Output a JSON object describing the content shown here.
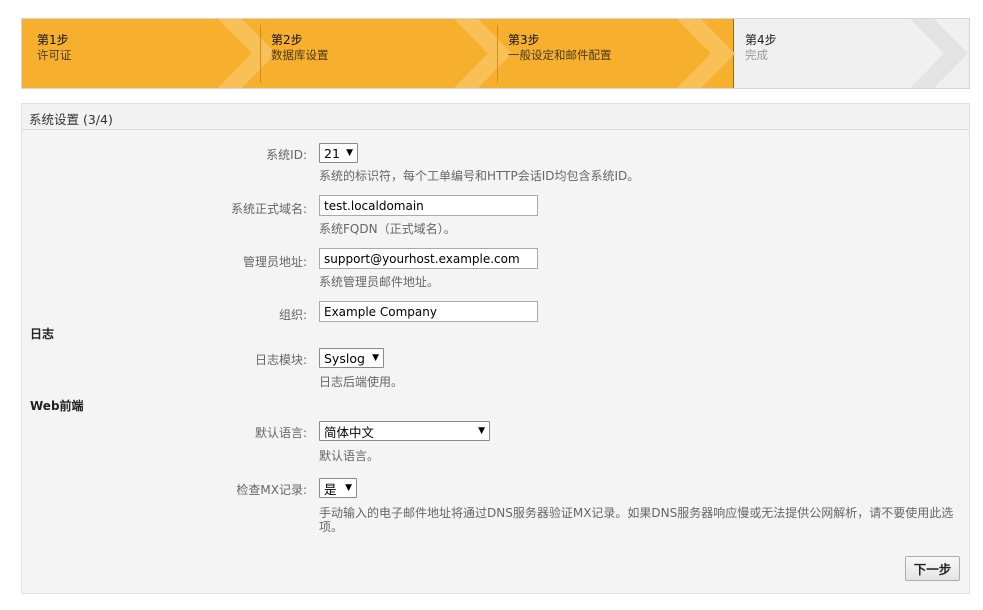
{
  "steps": [
    {
      "title": "第1步",
      "subtitle": "许可证",
      "state": "done"
    },
    {
      "title": "第2步",
      "subtitle": "数据库设置",
      "state": "done"
    },
    {
      "title": "第3步",
      "subtitle": "一般设定和邮件配置",
      "state": "current"
    },
    {
      "title": "第4步",
      "subtitle": "完成",
      "state": "pending"
    }
  ],
  "colors": {
    "active_step": "#f7b02e",
    "inactive_step": "#f0f0f0"
  },
  "panel": {
    "title": "系统设置 (3/4)",
    "fields": {
      "system_id": {
        "label": "系统ID:",
        "value": "21",
        "hint": "系统的标识符，每个工单编号和HTTP会话ID均包含系统ID。"
      },
      "fqdn": {
        "label": "系统正式域名:",
        "value": "test.localdomain",
        "hint": "系统FQDN（正式域名）。"
      },
      "admin_email": {
        "label": "管理员地址:",
        "value": "support@yourhost.example.com",
        "hint": "系统管理员邮件地址。"
      },
      "organization": {
        "label": "组织:",
        "value": "Example Company"
      }
    },
    "log_section": {
      "heading": "日志",
      "module": {
        "label": "日志模块:",
        "value": "Syslog",
        "hint": "日志后端使用。"
      }
    },
    "web_section": {
      "heading": "Web前端",
      "language": {
        "label": "默认语言:",
        "value": "简体中文",
        "hint": "默认语言。"
      },
      "mx_check": {
        "label": "检查MX记录:",
        "value": "是",
        "hint_line1": "手动输入的电子邮件地址将通过DNS服务器验证MX记录。如果DNS服务器响应慢或无法提供公网解析，请不要使用此选",
        "hint_line2": "项。"
      }
    },
    "next_button": "下一步"
  }
}
